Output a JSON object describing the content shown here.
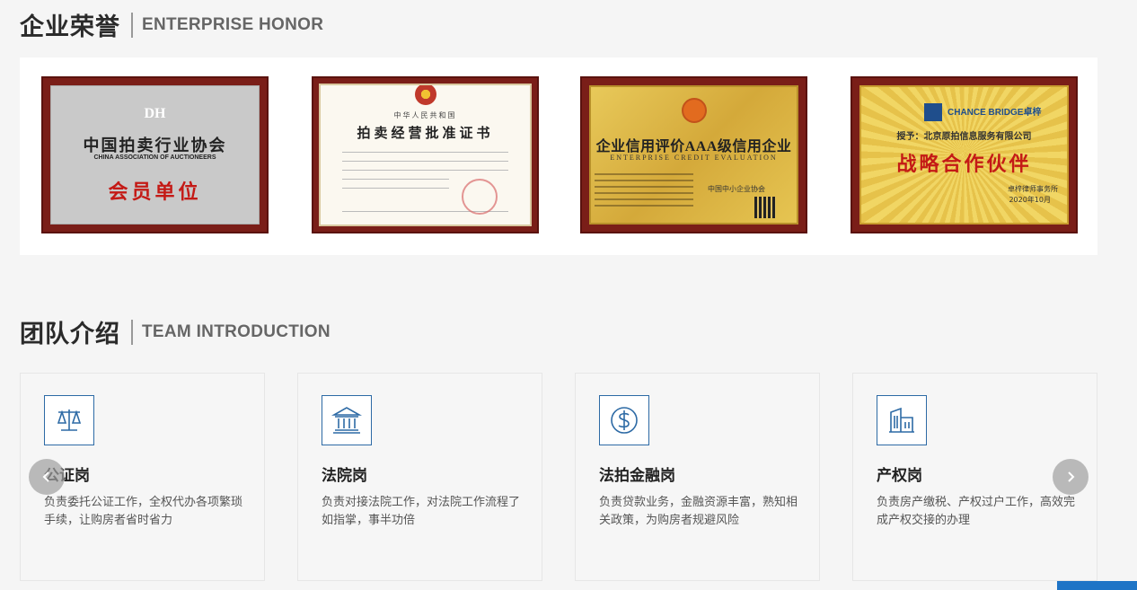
{
  "honor": {
    "title_cn": "企业荣誉",
    "title_en": "ENTERPRISE HONOR",
    "certificates": [
      {
        "logo": "DH",
        "org": "中国拍卖行业协会",
        "org_en": "CHINA ASSOCIATION OF AUCTIONEERS",
        "main": "会员单位"
      },
      {
        "top": "中华人民共和国",
        "title": "拍卖经营批准证书"
      },
      {
        "title": "企业信用评价AAA级信用企业",
        "sub": "ENTERPRISE CREDIT EVALUATION",
        "assoc": "中国中小企业协会"
      },
      {
        "brand": "CHANCE BRIDGE卓梓",
        "to": "授予：北京原拍信息服务有限公司",
        "main": "战略合作伙伴",
        "firm": "卓梓律师事务所",
        "date": "2020年10月"
      }
    ]
  },
  "team": {
    "title_cn": "团队介绍",
    "title_en": "TEAM INTRODUCTION",
    "cards": [
      {
        "icon": "scale-icon",
        "title": "公证岗",
        "desc": "负责委托公证工作，全权代办各项繁琐手续，让购房者省时省力"
      },
      {
        "icon": "courthouse-icon",
        "title": "法院岗",
        "desc": "负责对接法院工作，对法院工作流程了如指掌，事半功倍"
      },
      {
        "icon": "dollar-icon",
        "title": "法拍金融岗",
        "desc": "负责贷款业务，金融资源丰富，熟知相关政策，为购房者规避风险"
      },
      {
        "icon": "building-icon",
        "title": "产权岗",
        "desc": "负责房产缴税、产权过户工作，高效完成产权交接的办理"
      }
    ]
  },
  "colors": {
    "accent": "#2d6aa5",
    "red_text": "#c41a16"
  }
}
